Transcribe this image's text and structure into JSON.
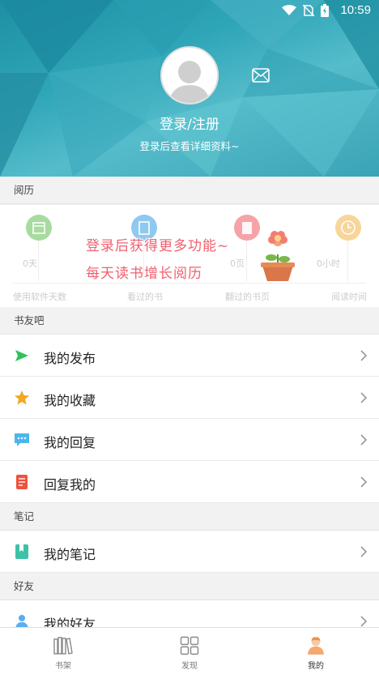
{
  "status_bar": {
    "time": "10:59"
  },
  "profile": {
    "login_title": "登录/注册",
    "login_subtitle": "登录后查看详细资料~"
  },
  "sections": {
    "history": "阅历",
    "book_club": "书友吧",
    "notes": "笔记",
    "friends": "好友"
  },
  "stats": [
    {
      "value": "0天",
      "label": "使用软件天数",
      "color": "#a8dba0"
    },
    {
      "value": "",
      "label": "看过的书",
      "color": "#8fc9f0"
    },
    {
      "value": "0页",
      "label": "翻过的书页",
      "color": "#f6a3a8"
    },
    {
      "value": "0小时",
      "label": "阅读时间",
      "color": "#f8d59a"
    }
  ],
  "overlay": {
    "line1": "登录后获得更多功能~",
    "line2": "每天读书增长阅历"
  },
  "menu": {
    "my_posts": "我的发布",
    "my_favorites": "我的收藏",
    "my_replies": "我的回复",
    "replies_to_me": "回复我的",
    "my_notes": "我的笔记",
    "my_friends": "我的好友"
  },
  "icons": {
    "posts": "send-icon",
    "favorites": "star-icon",
    "replies": "chat-bubble-icon",
    "replies_to_me": "document-icon",
    "notes": "bookmark-icon",
    "friends": "person-icon"
  },
  "colors": {
    "send": "#2fc25b",
    "star": "#f5a623",
    "chat": "#4cb6ec",
    "doc": "#f0523d",
    "note": "#3cc2a6",
    "friend": "#5aaef0"
  },
  "bottom_nav": [
    {
      "label": "书架"
    },
    {
      "label": "发现"
    },
    {
      "label": "我的"
    }
  ]
}
